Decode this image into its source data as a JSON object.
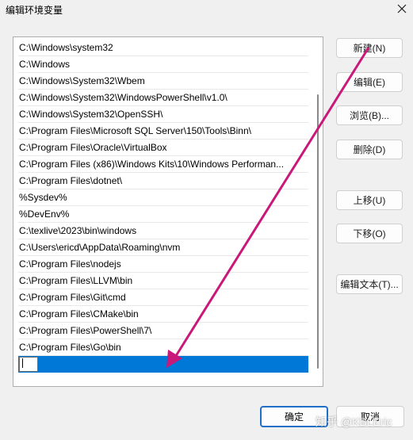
{
  "window": {
    "title": "编辑环境变量"
  },
  "paths": [
    "C:\\Windows\\system32",
    "C:\\Windows",
    "C:\\Windows\\System32\\Wbem",
    "C:\\Windows\\System32\\WindowsPowerShell\\v1.0\\",
    "C:\\Windows\\System32\\OpenSSH\\",
    "C:\\Program Files\\Microsoft SQL Server\\150\\Tools\\Binn\\",
    "C:\\Program Files\\Oracle\\VirtualBox",
    "C:\\Program Files (x86)\\Windows Kits\\10\\Windows Performan...",
    "C:\\Program Files\\dotnet\\",
    "%Sysdev%",
    "%DevEnv%",
    "C:\\texlive\\2023\\bin\\windows",
    "C:\\Users\\ericd\\AppData\\Roaming\\nvm",
    "C:\\Program Files\\nodejs",
    "C:\\Program Files\\LLVM\\bin",
    "C:\\Program Files\\Git\\cmd",
    "C:\\Program Files\\CMake\\bin",
    "C:\\Program Files\\PowerShell\\7\\",
    "C:\\Program Files\\Go\\bin"
  ],
  "new_entry": {
    "value": ""
  },
  "buttons": {
    "new": "新建(N)",
    "edit": "编辑(E)",
    "browse": "浏览(B)...",
    "delete": "删除(D)",
    "move_up": "上移(U)",
    "move_down": "下移(O)",
    "edit_text": "编辑文本(T)...",
    "ok": "确定",
    "cancel": "取消"
  },
  "watermark": "知乎 @KBLEric",
  "colors": {
    "selection": "#0078d7",
    "arrow": "#c8197a",
    "ok_border": "#1f6fc8"
  }
}
